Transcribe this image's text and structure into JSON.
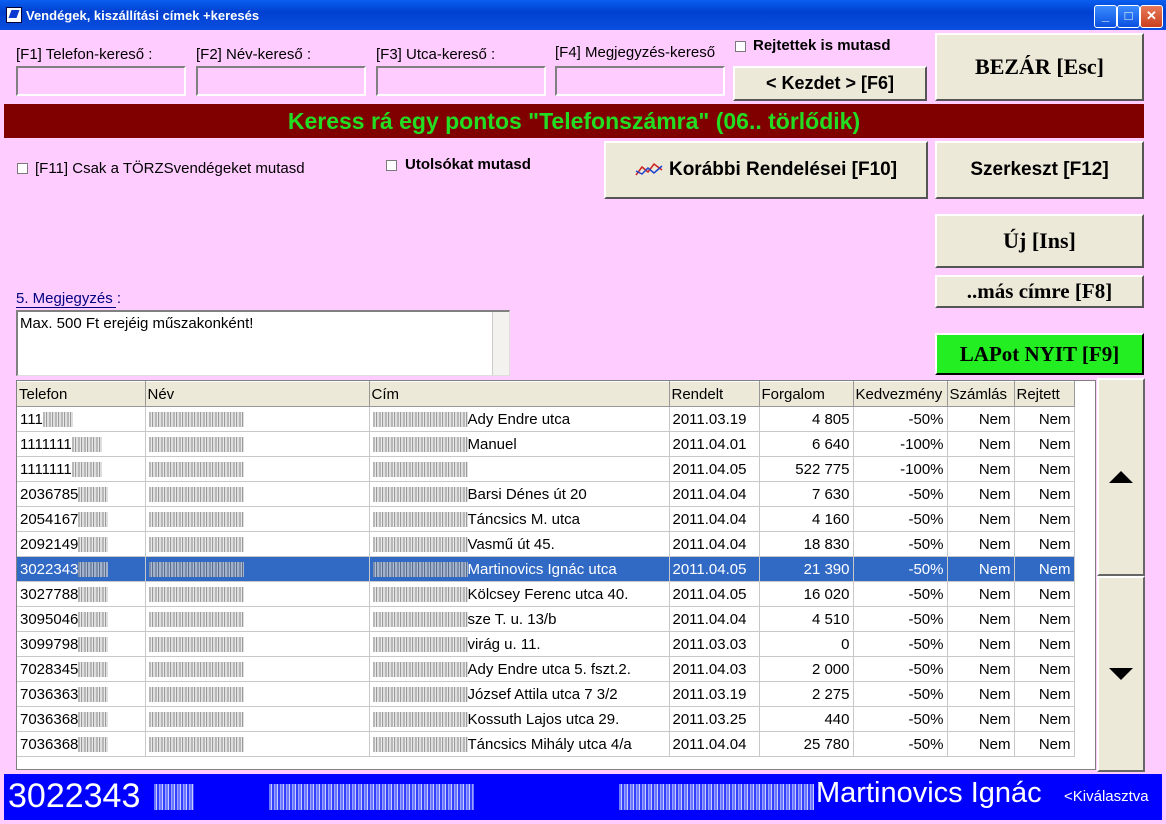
{
  "window": {
    "title": "Vendégek, kiszállítási címek +keresés",
    "min": "_",
    "max": "□",
    "close": "✕"
  },
  "search": {
    "phone_label": "[F1] Telefon-kereső :",
    "name_label": "[F2] Név-kereső :",
    "street_label": "[F3] Utca-kereső :",
    "note_label": "[F4] Megjegyzés-kereső"
  },
  "hidden_check_label": "Rejtettek is mutasd",
  "start_button": "< Kezdet > [F6]",
  "close_button": "BEZÁR [Esc]",
  "banner": "Keress rá egy pontos \"Telefonszámra\" (06.. törlődik)",
  "regular_check_label": "[F11] Csak a TÖRZSvendégeket mutasd",
  "last_check_label": "Utolsókat mutasd",
  "orders_button": "Korábbi Rendelései  [F10]",
  "edit_button": "Szerkeszt [F12]",
  "new_button": "Új [Ins]",
  "other_address_button": "..más címre [F8]",
  "open_sheet_button": "LAPot NYIT [F9]",
  "note": {
    "label": "5. Megjegyzés  :",
    "text": "Max. 500 Ft erejéig műszakonként!"
  },
  "table": {
    "columns": [
      "Telefon",
      "Név",
      "Cím",
      "Rendelt",
      "Forgalom",
      "Kedvezmény",
      "Számlás",
      "Rejtett"
    ],
    "rows": [
      {
        "phone": "111",
        "street": "Ady Endre utca",
        "date": "2011.03.19",
        "amount": "4 805",
        "discount": "-50%",
        "invoice": "Nem",
        "hidden": "Nem"
      },
      {
        "phone": "1111111",
        "street": "Manuel",
        "date": "2011.04.01",
        "amount": "6 640",
        "discount": "-100%",
        "invoice": "Nem",
        "hidden": "Nem"
      },
      {
        "phone": "1111111",
        "street": "",
        "date": "2011.04.05",
        "amount": "522 775",
        "discount": "-100%",
        "invoice": "Nem",
        "hidden": "Nem"
      },
      {
        "phone": "2036785",
        "street": "Barsi Dénes út 20",
        "date": "2011.04.04",
        "amount": "7 630",
        "discount": "-50%",
        "invoice": "Nem",
        "hidden": "Nem"
      },
      {
        "phone": "2054167",
        "street": "Táncsics M. utca",
        "date": "2011.04.04",
        "amount": "4 160",
        "discount": "-50%",
        "invoice": "Nem",
        "hidden": "Nem"
      },
      {
        "phone": "2092149",
        "street": "Vasmű út 45.",
        "date": "2011.04.04",
        "amount": "18 830",
        "discount": "-50%",
        "invoice": "Nem",
        "hidden": "Nem"
      },
      {
        "phone": "3022343",
        "street": "Martinovics Ignác utca",
        "date": "2011.04.05",
        "amount": "21 390",
        "discount": "-50%",
        "invoice": "Nem",
        "hidden": "Nem",
        "selected": true
      },
      {
        "phone": "3027788",
        "street": "Kölcsey Ferenc utca 40.",
        "date": "2011.04.05",
        "amount": "16 020",
        "discount": "-50%",
        "invoice": "Nem",
        "hidden": "Nem"
      },
      {
        "phone": "3095046",
        "street": "sze T. u. 13/b",
        "date": "2011.04.04",
        "amount": "4 510",
        "discount": "-50%",
        "invoice": "Nem",
        "hidden": "Nem"
      },
      {
        "phone": "3099798",
        "street": "virág u. 11.",
        "date": "2011.03.03",
        "amount": "0",
        "discount": "-50%",
        "invoice": "Nem",
        "hidden": "Nem"
      },
      {
        "phone": "7028345",
        "street": "Ady Endre utca 5. fszt.2.",
        "date": "2011.04.03",
        "amount": "2 000",
        "discount": "-50%",
        "invoice": "Nem",
        "hidden": "Nem"
      },
      {
        "phone": "7036363",
        "street": "József Attila utca  7 3/2",
        "date": "2011.03.19",
        "amount": "2 275",
        "discount": "-50%",
        "invoice": "Nem",
        "hidden": "Nem"
      },
      {
        "phone": "7036368",
        "street": "Kossuth Lajos utca 29.",
        "date": "2011.03.25",
        "amount": "440",
        "discount": "-50%",
        "invoice": "Nem",
        "hidden": "Nem"
      },
      {
        "phone": "7036368",
        "street": "Táncsics Mihály utca 4/a",
        "date": "2011.04.04",
        "amount": "25 780",
        "discount": "-50%",
        "invoice": "Nem",
        "hidden": "Nem"
      }
    ]
  },
  "status": {
    "phone": "3022343",
    "street": "Martinovics Ignác",
    "selected": "<Kiválasztva"
  },
  "icons": {
    "up": "arrow-up-icon",
    "down": "arrow-down-icon",
    "chart": "chart-icon"
  }
}
